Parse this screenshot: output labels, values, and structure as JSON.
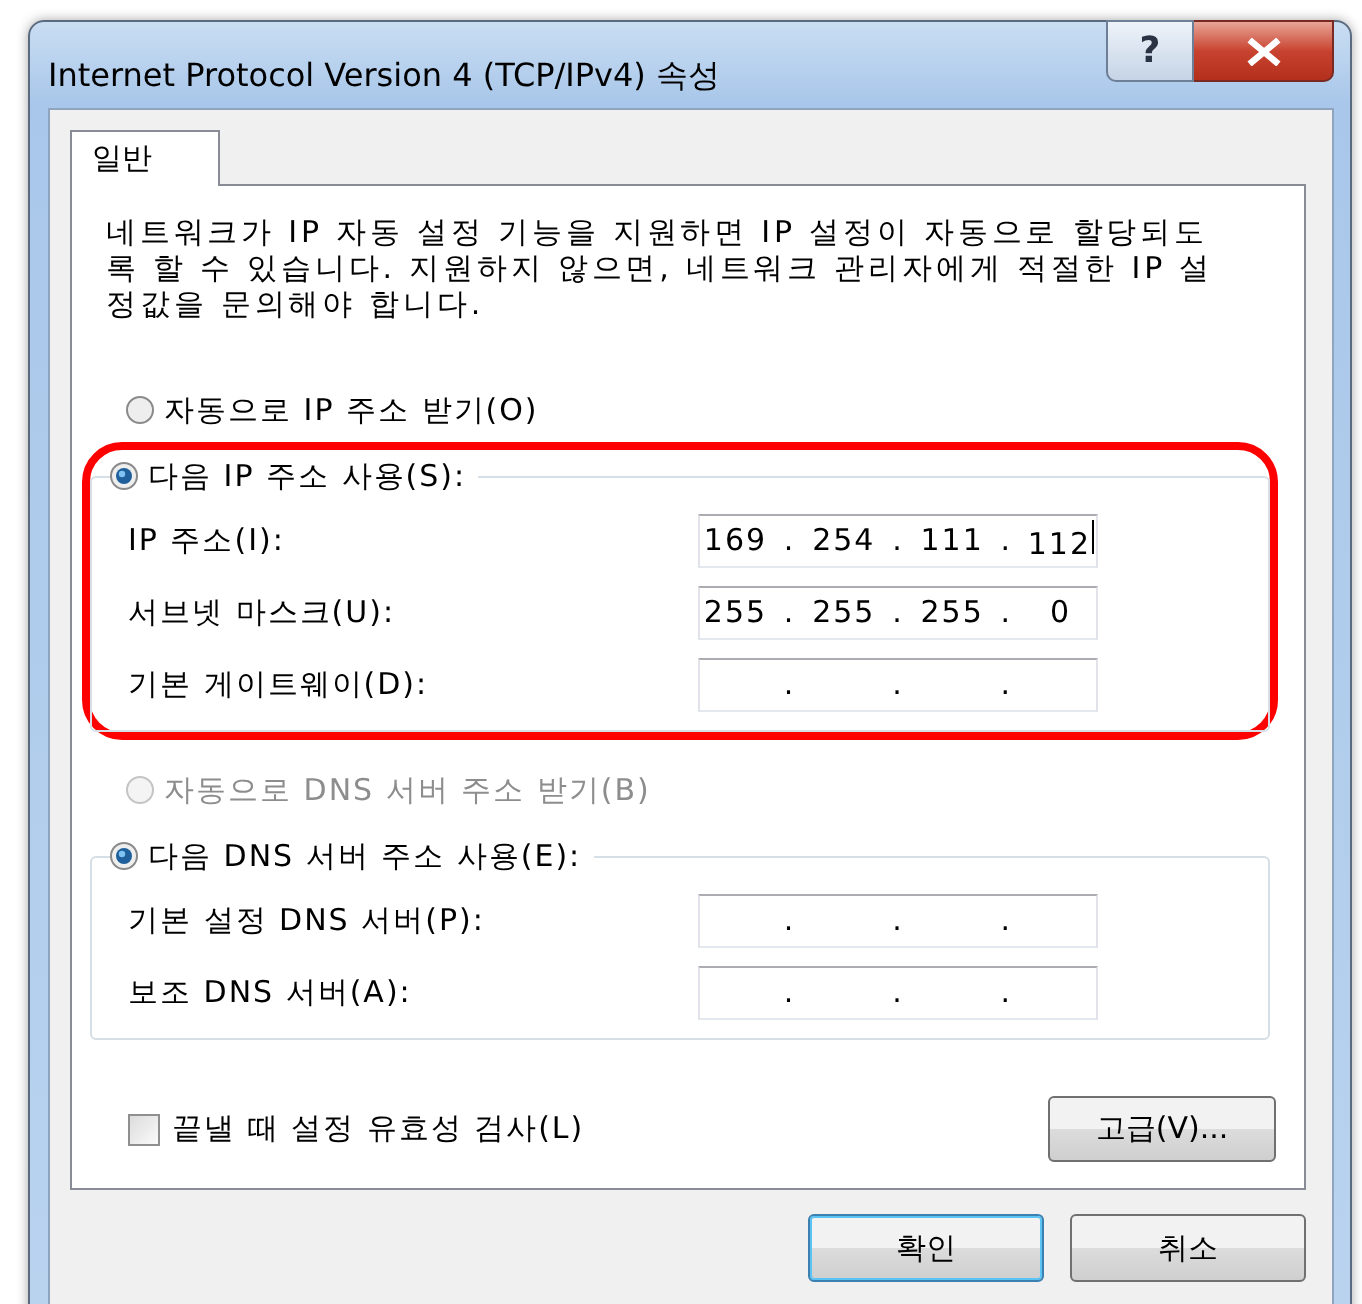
{
  "window": {
    "title": "Internet Protocol Version 4 (TCP/IPv4) 속성",
    "help_button": "?"
  },
  "tabs": [
    {
      "label": "일반",
      "selected": true
    }
  ],
  "description": "네트워크가 IP 자동 설정 기능을 지원하면 IP 설정이 자동으로 할당되도록 할 수 있습니다. 지원하지 않으면, 네트워크 관리자에게 적절한 IP 설정값을 문의해야 합니다.",
  "ip_settings": {
    "highlighted": true,
    "options": [
      {
        "label": "자동으로 IP 주소 받기(O)",
        "selected": false,
        "disabled": false
      },
      {
        "label": "다음 IP 주소 사용(S):",
        "selected": true,
        "disabled": false
      }
    ],
    "fields": [
      {
        "label": "IP 주소(I):",
        "octets": [
          "169",
          "254",
          "111",
          "112"
        ],
        "dots": [
          ".",
          ".",
          "."
        ],
        "focused": true
      },
      {
        "label": "서브넷 마스크(U):",
        "octets": [
          "255",
          "255",
          "255",
          "0"
        ],
        "dots": [
          ".",
          ".",
          "."
        ],
        "focused": false
      },
      {
        "label": "기본 게이트웨이(D):",
        "dots": [
          ".",
          ".",
          "."
        ],
        "focused": false
      }
    ]
  },
  "dns_settings": {
    "highlighted": false,
    "options": [
      {
        "label": "자동으로 DNS 서버 주소 받기(B)",
        "selected": false,
        "disabled": true
      },
      {
        "label": "다음 DNS 서버 주소 사용(E):",
        "selected": true,
        "disabled": false
      }
    ],
    "fields": [
      {
        "label": "기본 설정 DNS 서버(P):",
        "dots": [
          ".",
          ".",
          "."
        ],
        "focused": false
      },
      {
        "label": "보조 DNS 서버(A):",
        "dots": [
          ".",
          ".",
          "."
        ],
        "focused": false
      }
    ]
  },
  "validate_checkbox": {
    "label": "끝낼 때 설정 유효성 검사(L)",
    "checked": false
  },
  "advanced_button": "고급(V)...",
  "buttons": [
    {
      "label": "확인",
      "default": true
    },
    {
      "label": "취소",
      "default": false
    }
  ]
}
